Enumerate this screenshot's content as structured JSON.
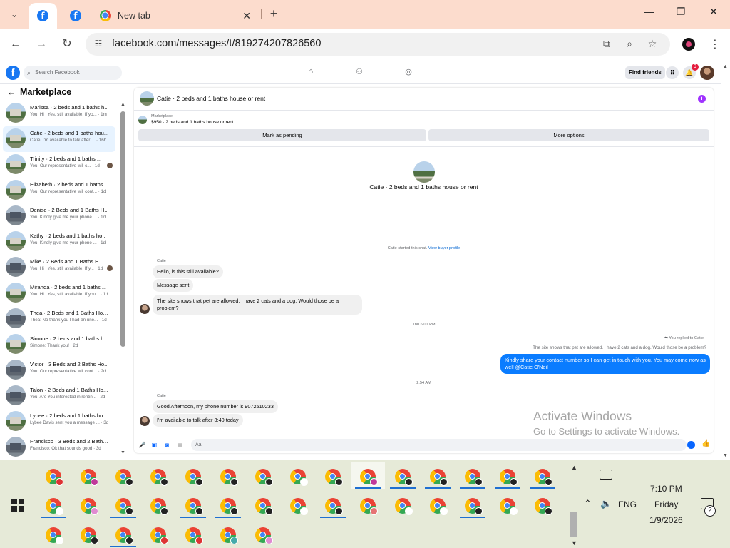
{
  "browser": {
    "tabs": [
      {
        "title": "",
        "icon": "facebook-icon",
        "active": true
      },
      {
        "title": "",
        "icon": "facebook-icon",
        "active": false
      },
      {
        "title": "New tab",
        "icon": "chrome-icon",
        "active": false
      }
    ],
    "url": "facebook.com/messages/t/819274207826560"
  },
  "fb_header": {
    "search_placeholder": "Search Facebook",
    "find_friends": "Find friends",
    "notification_count": "9"
  },
  "sidebar": {
    "title": "Marketplace",
    "conversations": [
      {
        "name": "Marissa · 2 beds and 1 baths h...",
        "preview": "You: Hi ! Yes, still available. If yo... · 1m",
        "avatar": "house"
      },
      {
        "name": "Catie · 2 beds and 1 baths hou...",
        "preview": "Catie: I'm available to talk after ... · 16h",
        "avatar": "house",
        "selected": true
      },
      {
        "name": "Trinity · 2 beds and 1 baths ...",
        "preview": "You: Our representative will c... · 1d",
        "avatar": "house",
        "seen": true
      },
      {
        "name": "Elizabeth · 2 beds and 1 baths ...",
        "preview": "You: Our representative will cont... · 1d",
        "avatar": "house"
      },
      {
        "name": "Denise · 2 Beds and 1 Baths H...",
        "preview": "You: Kindly give me your phone ... · 1d",
        "avatar": "dark"
      },
      {
        "name": "Kathy · 2 beds and 1 baths ho...",
        "preview": "You: Kindly give me your phone ... · 1d",
        "avatar": "house"
      },
      {
        "name": "Mike · 2 Beds and 1 Baths H...",
        "preview": "You: Hi ! Yes, still available. If y... · 1d",
        "avatar": "dark",
        "seen": true
      },
      {
        "name": "Miranda · 2 beds and 1 baths ...",
        "preview": "You: Hi ! Yes, still available. If you... · 1d",
        "avatar": "house"
      },
      {
        "name": "Thea · 2 Beds and 1 Baths Hou...",
        "preview": "Thea: No thank you I had an une... · 1d",
        "avatar": "dark"
      },
      {
        "name": "Simone · 2 beds and 1 baths h...",
        "preview": "Simone: Thank you! · 2d",
        "avatar": "house"
      },
      {
        "name": "Victor · 3 Beds and 2 Baths Ho...",
        "preview": "You: Our representative will cont... · 2d",
        "avatar": "dark"
      },
      {
        "name": "Talon · 2 Beds and 1 Baths Ho...",
        "preview": "You: Are You interested in rentin... · 2d",
        "avatar": "dark"
      },
      {
        "name": "Lybee · 2 beds and 1 baths ho...",
        "preview": "Lybee Davis sent you a message ... · 3d",
        "avatar": "house"
      },
      {
        "name": "Francisco · 3 Beds and 2 Baths...",
        "preview": "Francisco: Ok that sounds good · 3d",
        "avatar": "dark"
      }
    ]
  },
  "chat": {
    "title": "Catie · 2 beds and 1 baths house or rent",
    "marketplace_label": "Marketplace",
    "listing": "$950 · 2 beds and 1 baths house or rent",
    "mark_pending": "Mark as pending",
    "more_options": "More options",
    "center_title": "Catie · 2 beds and 1 baths house or rent",
    "started_note": "Catie started this chat.",
    "view_profile": "View buyer profile",
    "sender1": "Catie",
    "msg1": "Hello, is this still available?",
    "msg2": "Message sent",
    "msg3": "The site shows that pet are allowed. I have 2 cats and a dog. Would those be a problem?",
    "time1": "Thu 6:01 PM",
    "reply_note": "You replied to Catie",
    "reply_quote": "The site shows that pet are allowed. I have 2 cats and a dog. Would those be a problem?",
    "out1": "Kindly share your contact number so I can get in touch with you. You may come now as well @Catie O'Neil",
    "time2": "2:54 AM",
    "sender2": "Catie",
    "msg4": "Good Afternoon, my phone number is 9072510233",
    "msg5": "I'm available to talk after 3:40 today",
    "composer_placeholder": "Aa"
  },
  "watermark": {
    "line1": "Activate Windows",
    "line2": "Go to Settings to activate Windows."
  },
  "taskbar": {
    "time": "7:10 PM",
    "day": "Friday",
    "date": "1/9/2026",
    "lang": "ENG",
    "notifications": "2"
  }
}
